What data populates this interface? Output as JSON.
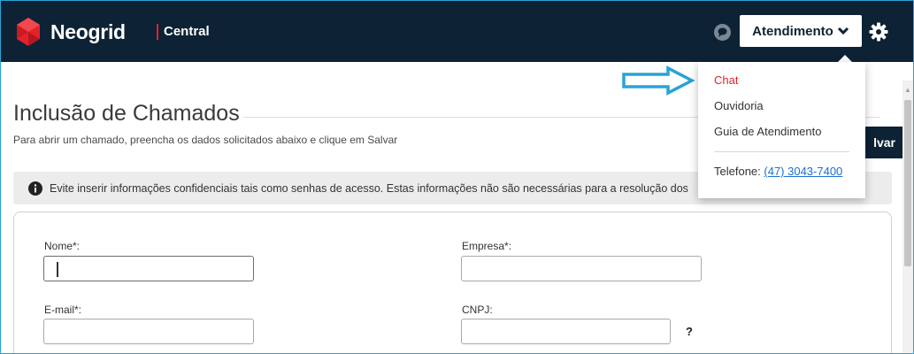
{
  "header": {
    "brand": "Neogrid",
    "product": "Central",
    "atendimento_label": "Atendimento",
    "icons": [
      "neogrid-logo-icon",
      "chat-status-icon",
      "chevron-down-icon",
      "gear-icon"
    ]
  },
  "menu": {
    "items": [
      {
        "label": "Chat",
        "active": true
      },
      {
        "label": "Ouvidoria"
      },
      {
        "label": "Guia de Atendimento"
      }
    ],
    "telefone_label": "Telefone:",
    "telefone_number": "(47) 3043-7400"
  },
  "page": {
    "title": "Inclusão de Chamados",
    "subtitle": "Para abrir um chamado, preencha os dados solicitados abaixo e clique em Salvar",
    "save_label": "lvar",
    "notice": "Evite inserir informações confidenciais tais como senhas de acesso. Estas informações não são necessárias para a resolução dos"
  },
  "form": {
    "nome_label": "Nome*:",
    "empresa_label": "Empresa*:",
    "email_label": "E-mail*:",
    "cnpj_label": "CNPJ:",
    "help_label": "?"
  },
  "colors": {
    "header_bg": "#0d2234",
    "accent_red": "#e3232b",
    "link_blue": "#1d6fd1",
    "annotation_arrow": "#29a3d6"
  }
}
